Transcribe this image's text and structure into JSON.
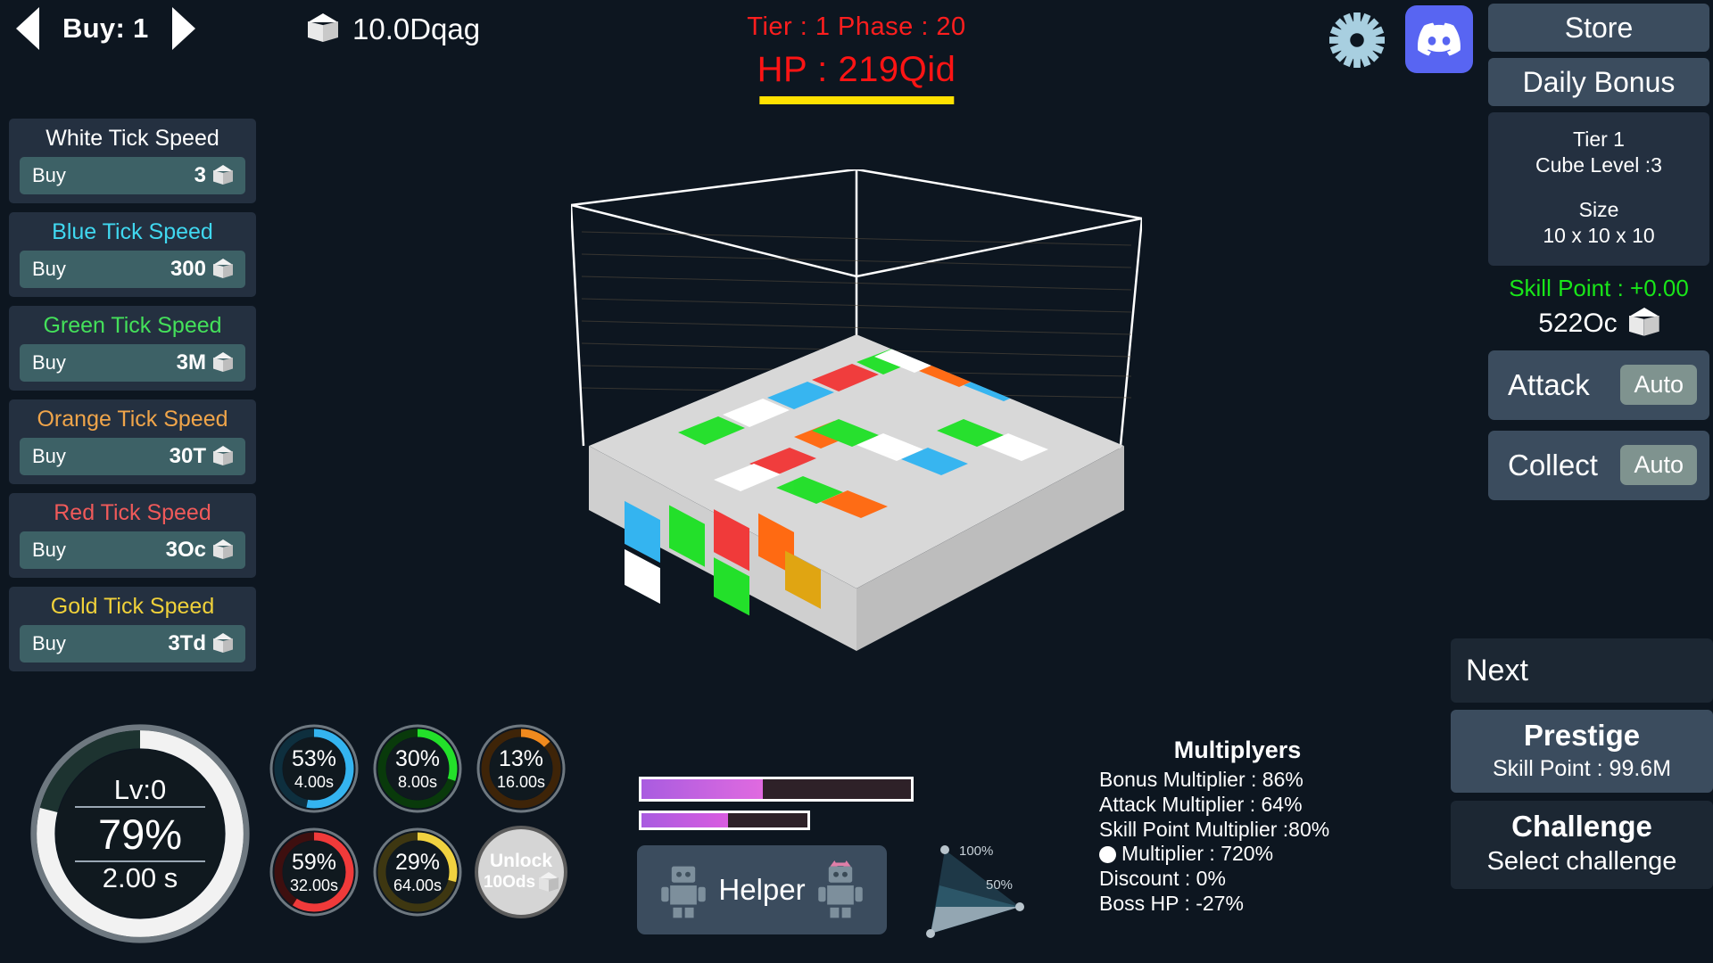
{
  "topbar": {
    "prev_label": "prev-buy-amount",
    "next_label": "next-buy-amount",
    "buy_label": "Buy: 1",
    "currency_value": "10.0Dqag",
    "gear_label": "settings",
    "discord_label": "discord"
  },
  "battle": {
    "tier_phase": "Tier : 1 Phase : 20",
    "hp": "HP : 219Qid"
  },
  "upgrades": [
    {
      "name": "White Tick Speed",
      "color": "#ffffff",
      "buy_label": "Buy",
      "cost": "3"
    },
    {
      "name": "Blue Tick Speed",
      "color": "#40d8f0",
      "buy_label": "Buy",
      "cost": "300"
    },
    {
      "name": "Green Tick Speed",
      "color": "#44e05a",
      "buy_label": "Buy",
      "cost": "3M"
    },
    {
      "name": "Orange Tick Speed",
      "color": "#f0a54a",
      "buy_label": "Buy",
      "cost": "30T"
    },
    {
      "name": "Red Tick Speed",
      "color": "#f05a5a",
      "buy_label": "Buy",
      "cost": "3Oc"
    },
    {
      "name": "Gold Tick Speed",
      "color": "#f0d13a",
      "buy_label": "Buy",
      "cost": "3Td"
    }
  ],
  "meters": {
    "main": {
      "level": "Lv:0",
      "percent": "79%",
      "seconds": "2.00 s",
      "value": 79,
      "color": "#f2f2f2"
    },
    "small": [
      {
        "percent": "53%",
        "seconds": "4.00s",
        "value": 53,
        "color": "#34b4f0"
      },
      {
        "percent": "30%",
        "seconds": "8.00s",
        "value": 30,
        "color": "#23e02a"
      },
      {
        "percent": "13%",
        "seconds": "16.00s",
        "value": 13,
        "color": "#f08a1e"
      },
      {
        "percent": "59%",
        "seconds": "32.00s",
        "value": 59,
        "color": "#f03a3a"
      },
      {
        "percent": "29%",
        "seconds": "64.00s",
        "value": 29,
        "color": "#f0d240"
      }
    ],
    "unlock": {
      "line1": "Unlock",
      "line2": "10Ods"
    }
  },
  "bars": {
    "bar_one_percent": 45,
    "bar_two_percent": 52
  },
  "helper": {
    "label": "Helper"
  },
  "radar": {
    "outer_label": "100%",
    "inner_label": "50%"
  },
  "multipliers": {
    "title": "Multiplyers",
    "rows": [
      {
        "label": "Bonus Multiplier : 86%",
        "icon": "none"
      },
      {
        "label": "Attack Multiplier : 64%",
        "icon": "none"
      },
      {
        "label": "Skill Point Multiplier :80%",
        "icon": "none"
      },
      {
        "label": "Multiplier : 720%",
        "icon": "white-dot"
      },
      {
        "label": "Discount : 0%",
        "icon": "none"
      },
      {
        "label": "Boss HP : -27%",
        "icon": "none"
      }
    ]
  },
  "right": {
    "store_label": "Store",
    "daily_bonus_label": "Daily Bonus",
    "tier_label": "Tier 1",
    "cube_level_label": "Cube Level :3",
    "size_title": "Size",
    "size_value": "10 x 10 x 10",
    "skill_point": "Skill Point : +0.00",
    "cube_amount": "522Oc",
    "attack_label": "Attack",
    "attack_auto_label": "Auto",
    "collect_label": "Collect",
    "collect_auto_label": "Auto",
    "next_label": "Next",
    "prestige_title": "Prestige",
    "prestige_sub": "Skill Point : 99.6M",
    "challenge_title": "Challenge",
    "challenge_sub": "Select challenge"
  },
  "colors": {
    "background": "#0d1620",
    "panel": "#243040",
    "button": "#3b4c5e",
    "buy_button": "#3d6166",
    "hp_red": "#ff1414",
    "skill_green": "#19e619",
    "hp_bar_yellow": "#ffe100",
    "discord_blurple": "#5865f2"
  }
}
